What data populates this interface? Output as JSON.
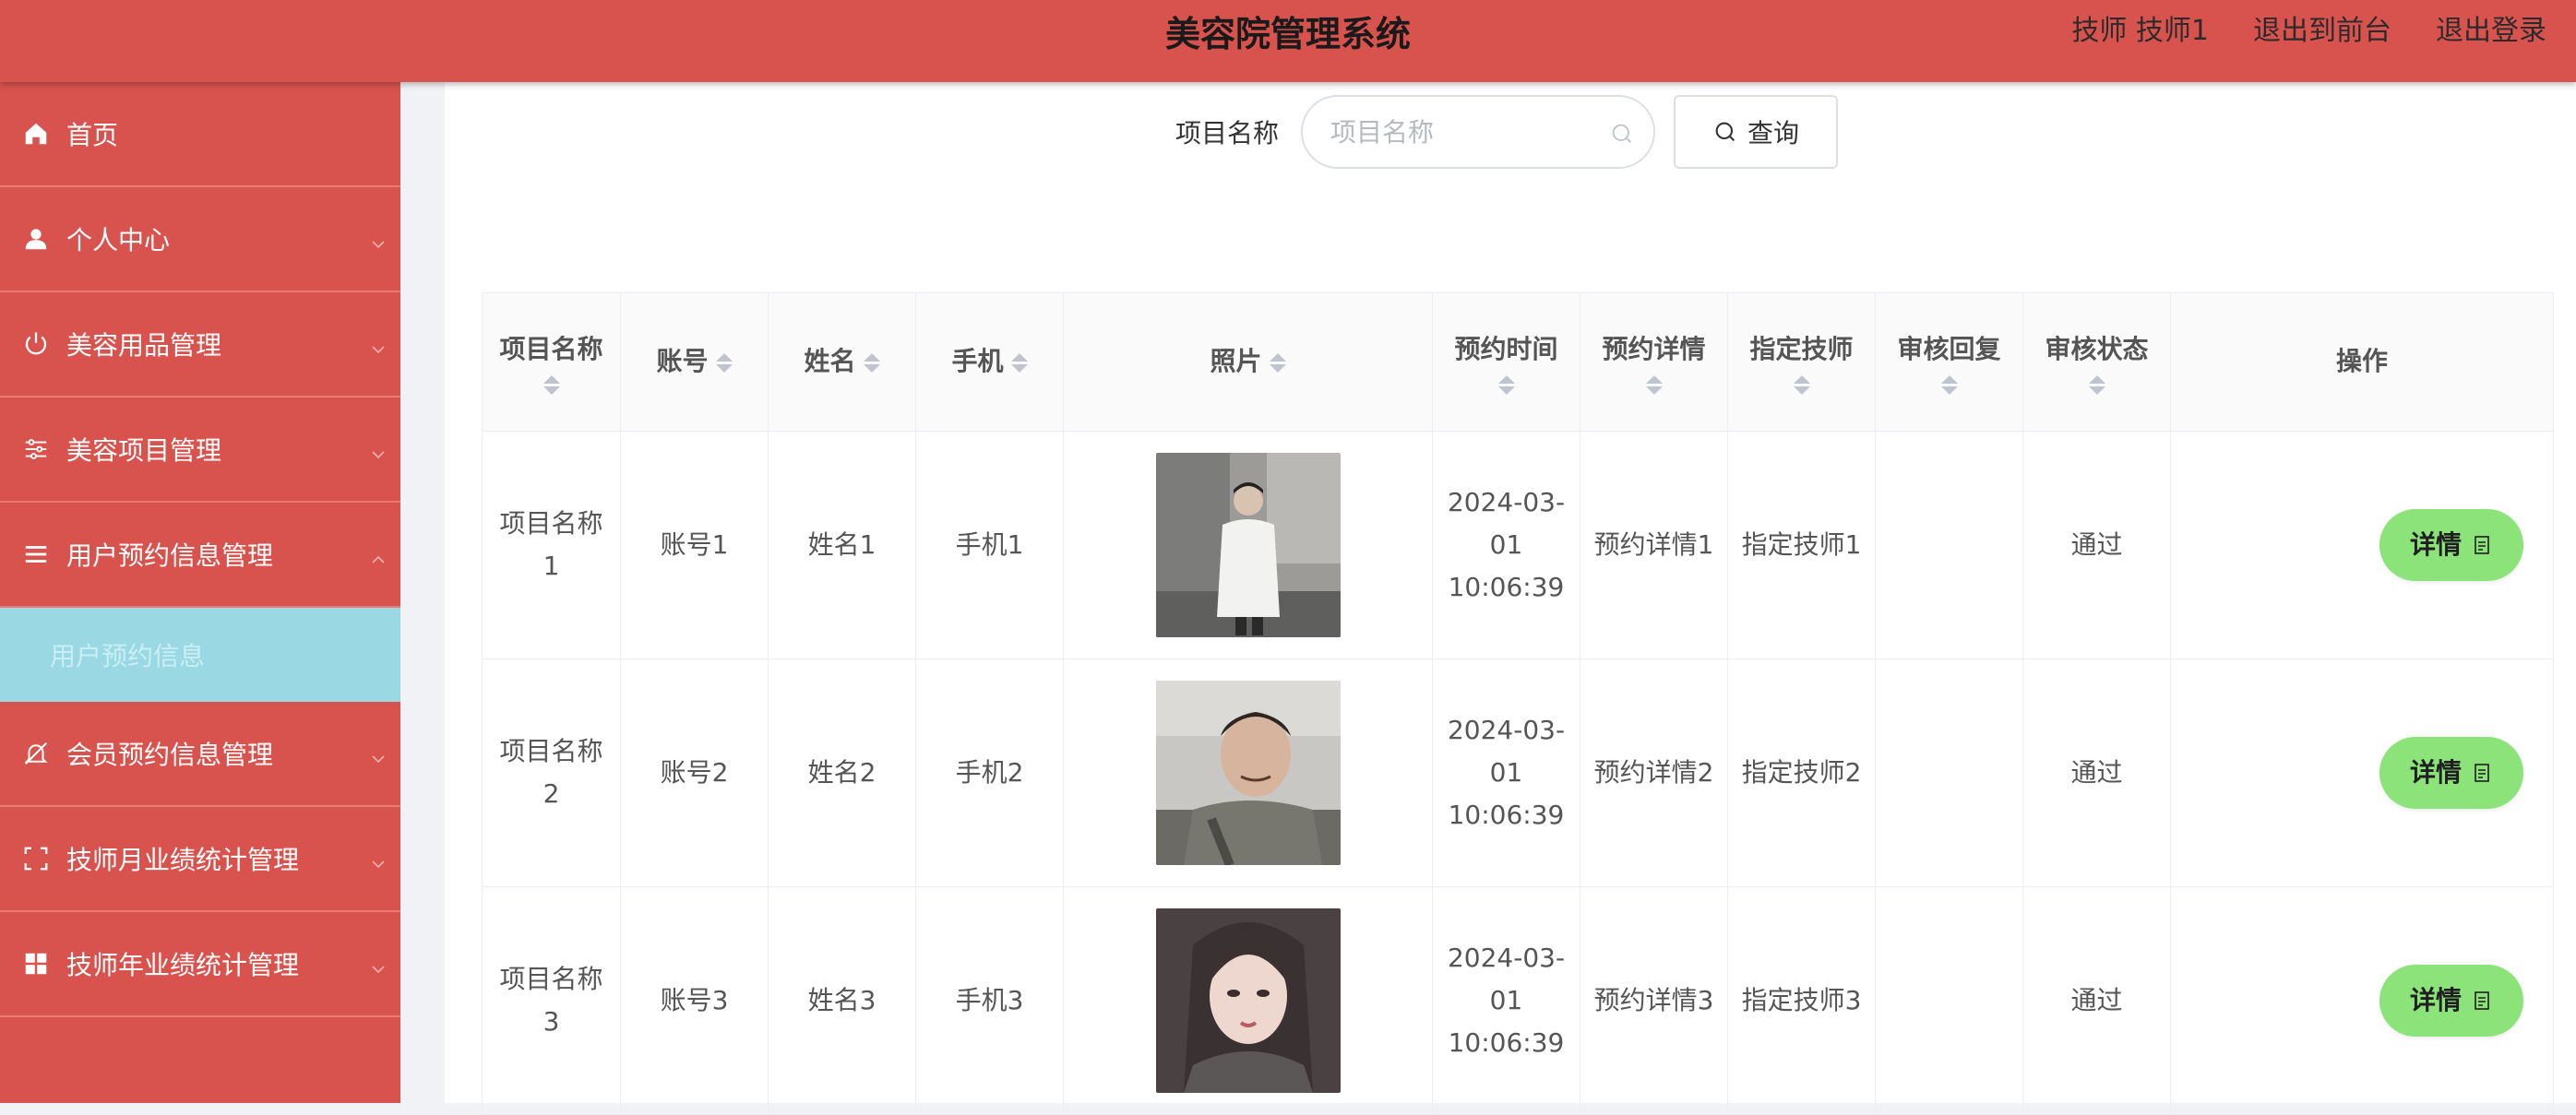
{
  "header": {
    "title": "美容院管理系统",
    "user": "技师 技师1",
    "to_front": "退出到前台",
    "logout": "退出登录"
  },
  "sidebar": {
    "items": [
      {
        "label": "首页",
        "icon": "home-icon"
      },
      {
        "label": "个人中心",
        "icon": "user-icon"
      },
      {
        "label": "美容用品管理",
        "icon": "power-icon"
      },
      {
        "label": "美容项目管理",
        "icon": "sliders-icon"
      },
      {
        "label": "用户预约信息管理",
        "icon": "list-icon",
        "expanded": true
      },
      {
        "label": "会员预约信息管理",
        "icon": "bell-off-icon"
      },
      {
        "label": "技师月业绩统计管理",
        "icon": "frame-icon"
      },
      {
        "label": "技师年业绩统计管理",
        "icon": "grid-icon"
      }
    ],
    "active_sub": "用户预约信息"
  },
  "search": {
    "label": "项目名称",
    "placeholder": "项目名称",
    "button": "查询"
  },
  "table": {
    "headers": [
      "项目名称",
      "账号",
      "姓名",
      "手机",
      "照片",
      "预约时间",
      "预约详情",
      "指定技师",
      "审核回复",
      "审核状态",
      "操作"
    ],
    "rows": [
      {
        "project": "项目名称1",
        "account": "账号1",
        "name": "姓名1",
        "phone": "手机1",
        "photo": "photo-person-1",
        "time": "2024-03-01 10:06:39",
        "detail": "预约详情1",
        "tech": "指定技师1",
        "reply": "",
        "status": "通过",
        "action": "详情"
      },
      {
        "project": "项目名称2",
        "account": "账号2",
        "name": "姓名2",
        "phone": "手机2",
        "photo": "photo-person-2",
        "time": "2024-03-01 10:06:39",
        "detail": "预约详情2",
        "tech": "指定技师2",
        "reply": "",
        "status": "通过",
        "action": "详情"
      },
      {
        "project": "项目名称3",
        "account": "账号3",
        "name": "姓名3",
        "phone": "手机3",
        "photo": "photo-person-3",
        "time": "2024-03-01 10:06:39",
        "detail": "预约详情3",
        "tech": "指定技师3",
        "reply": "",
        "status": "通过",
        "action": "详情"
      }
    ]
  },
  "colors": {
    "primary": "#d9534e",
    "submenu_active": "#9ad9e4",
    "detail_button": "#8be37a"
  }
}
